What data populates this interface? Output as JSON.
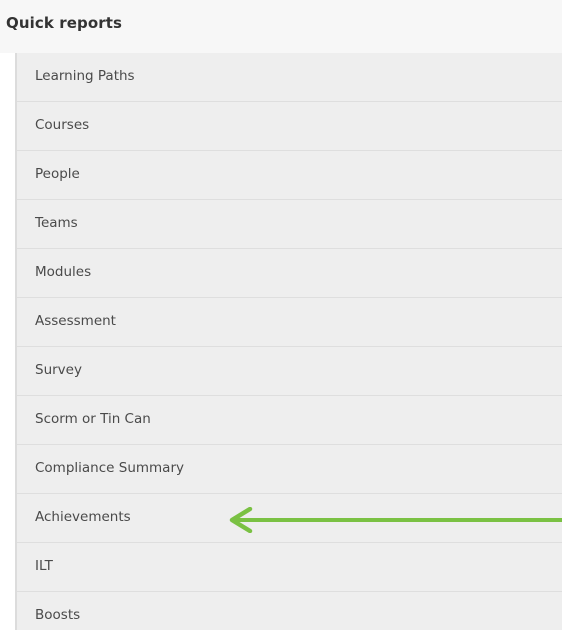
{
  "header": {
    "title": "Quick reports"
  },
  "reports": [
    {
      "label": "Learning Paths"
    },
    {
      "label": "Courses"
    },
    {
      "label": "People"
    },
    {
      "label": "Teams"
    },
    {
      "label": "Modules"
    },
    {
      "label": "Assessment"
    },
    {
      "label": "Survey"
    },
    {
      "label": "Scorm or Tin Can"
    },
    {
      "label": "Compliance Summary"
    },
    {
      "label": "Achievements"
    },
    {
      "label": "ILT"
    },
    {
      "label": "Boosts"
    }
  ],
  "annotation": {
    "arrow_color": "#7ac143",
    "points_to": "Achievements"
  }
}
